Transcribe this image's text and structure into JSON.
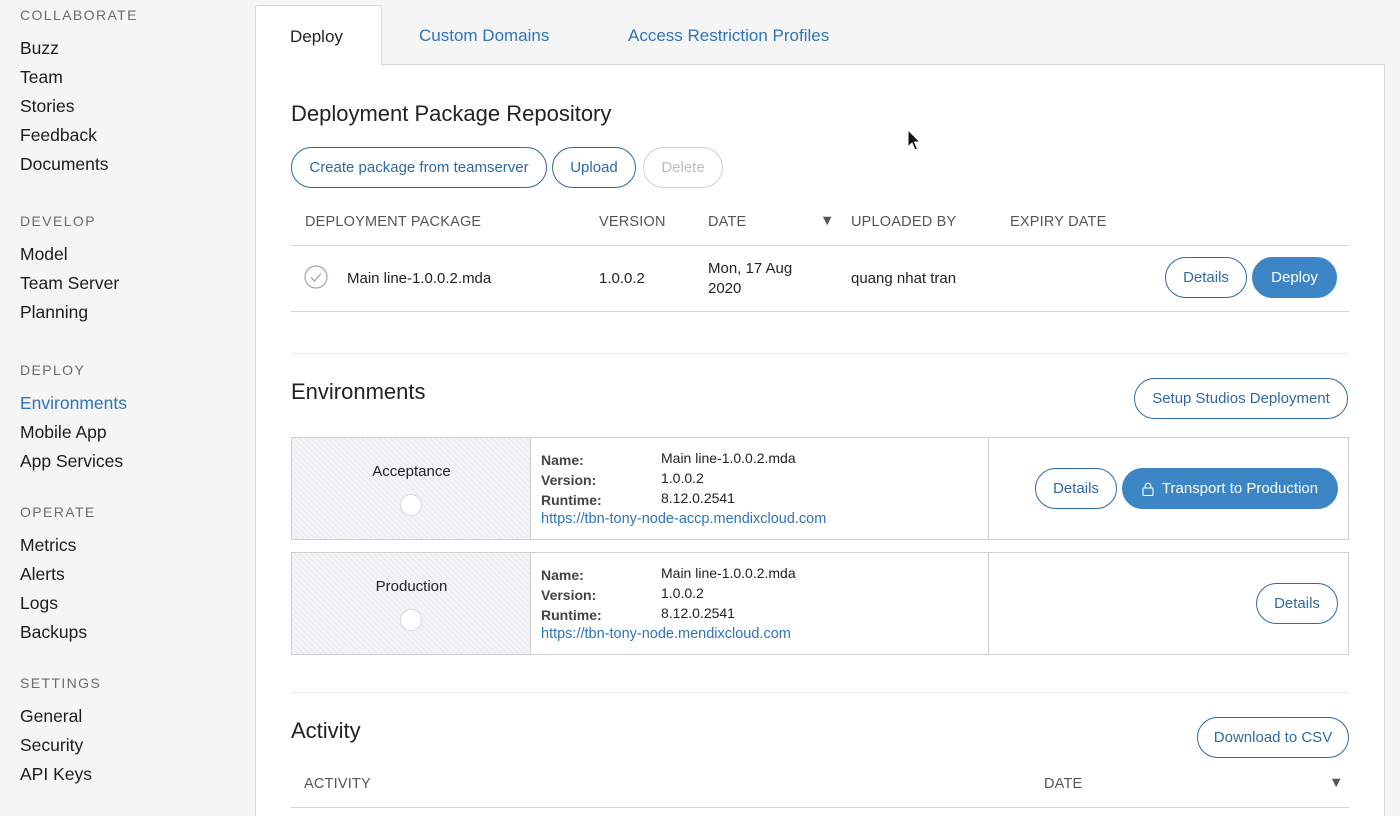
{
  "sidebar": {
    "sections": [
      {
        "heading": "COLLABORATE",
        "items": [
          "Buzz",
          "Team",
          "Stories",
          "Feedback",
          "Documents"
        ]
      },
      {
        "heading": "DEVELOP",
        "items": [
          "Model",
          "Team Server",
          "Planning"
        ]
      },
      {
        "heading": "DEPLOY",
        "items": [
          "Environments",
          "Mobile App",
          "App Services"
        ]
      },
      {
        "heading": "OPERATE",
        "items": [
          "Metrics",
          "Alerts",
          "Logs",
          "Backups"
        ]
      },
      {
        "heading": "SETTINGS",
        "items": [
          "General",
          "Security",
          "API Keys"
        ]
      }
    ],
    "active_item": "Environments"
  },
  "tabs": [
    "Deploy",
    "Custom Domains",
    "Access Restriction Profiles"
  ],
  "repository": {
    "title": "Deployment Package Repository",
    "buttons": {
      "create": "Create package from teamserver",
      "upload": "Upload",
      "delete": "Delete"
    },
    "columns": [
      "DEPLOYMENT PACKAGE",
      "VERSION",
      "DATE",
      "UPLOADED BY",
      "EXPIRY DATE"
    ],
    "sort_indicator": "▼",
    "rows": [
      {
        "package": "Main line-1.0.0.2.mda",
        "version": "1.0.0.2",
        "date_line1": "Mon, 17 Aug",
        "date_line2": "2020",
        "uploaded_by": "quang nhat tran",
        "expiry": "",
        "details_label": "Details",
        "deploy_label": "Deploy"
      }
    ]
  },
  "environments": {
    "title": "Environments",
    "setup_button": "Setup Studios Deployment",
    "labels": {
      "name": "Name:",
      "version": "Version:",
      "runtime": "Runtime:"
    },
    "items": [
      {
        "env": "Acceptance",
        "name": "Main line-1.0.0.2.mda",
        "version": "1.0.0.2",
        "runtime": "8.12.0.2541",
        "url": "https://tbn-tony-node-accp.mendixcloud.com",
        "details_label": "Details",
        "transport_label": "Transport to Production"
      },
      {
        "env": "Production",
        "name": "Main line-1.0.0.2.mda",
        "version": "1.0.0.2",
        "runtime": "8.12.0.2541",
        "url": "https://tbn-tony-node.mendixcloud.com",
        "details_label": "Details"
      }
    ]
  },
  "activity": {
    "title": "Activity",
    "download_button": "Download to CSV",
    "columns": [
      "ACTIVITY",
      "DATE"
    ],
    "sort_indicator": "▼"
  },
  "colors": {
    "accent": "#2f74b5",
    "primary_button": "#3d86c6"
  }
}
